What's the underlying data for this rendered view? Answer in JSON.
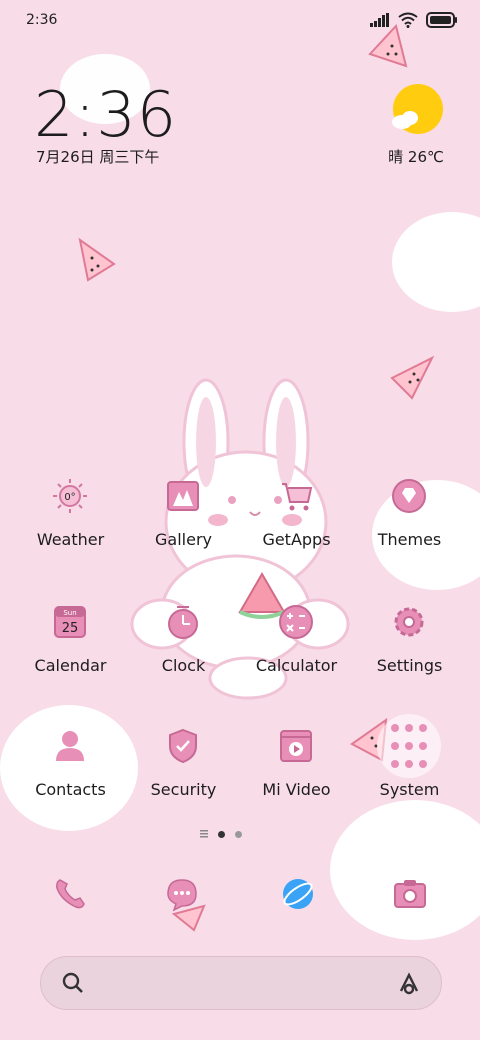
{
  "status_bar": {
    "time": "2:36"
  },
  "clock_widget": {
    "time": "2:36",
    "date": "7月26日 周三下午"
  },
  "weather_widget": {
    "text": "晴 26℃",
    "icon": "sun-cloud-icon"
  },
  "apps": [
    {
      "label": "Weather",
      "icon": "weather-icon",
      "glyph": "0°"
    },
    {
      "label": "Gallery",
      "icon": "gallery-icon"
    },
    {
      "label": "GetApps",
      "icon": "getapps-cart-icon"
    },
    {
      "label": "Themes",
      "icon": "themes-diamond-icon"
    },
    {
      "label": "Calendar",
      "icon": "calendar-icon",
      "glyph_day": "Sun",
      "glyph_date": "25"
    },
    {
      "label": "Clock",
      "icon": "clock-icon"
    },
    {
      "label": "Calculator",
      "icon": "calculator-icon"
    },
    {
      "label": "Settings",
      "icon": "gear-icon"
    },
    {
      "label": "Contacts",
      "icon": "contacts-icon"
    },
    {
      "label": "Security",
      "icon": "shield-icon"
    },
    {
      "label": "Mi Video",
      "icon": "video-icon"
    },
    {
      "label": "System",
      "icon": "folder-icon"
    }
  ],
  "page_indicator": {
    "pages": 2,
    "current": 1
  },
  "dock": [
    {
      "icon": "phone-icon"
    },
    {
      "icon": "messages-icon"
    },
    {
      "icon": "browser-icon"
    },
    {
      "icon": "camera-icon"
    }
  ],
  "colors": {
    "background": "#f8dce8",
    "accent_pink": "#e68fb5",
    "sun": "#ffcc10"
  }
}
